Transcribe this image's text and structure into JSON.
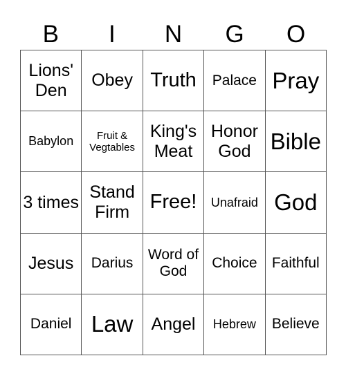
{
  "header": [
    "B",
    "I",
    "N",
    "G",
    "O"
  ],
  "cells": [
    [
      "Lions' Den",
      "Obey",
      "Truth",
      "Palace",
      "Pray"
    ],
    [
      "Babylon",
      "Fruit & Vegtables",
      "King's Meat",
      "Honor God",
      "Bible"
    ],
    [
      "3 times",
      "Stand Firm",
      "Free!",
      "Unafraid",
      "God"
    ],
    [
      "Jesus",
      "Darius",
      "Word of God",
      "Choice",
      "Faithful"
    ],
    [
      "Daniel",
      "Law",
      "Angel",
      "Hebrew",
      "Believe"
    ]
  ]
}
